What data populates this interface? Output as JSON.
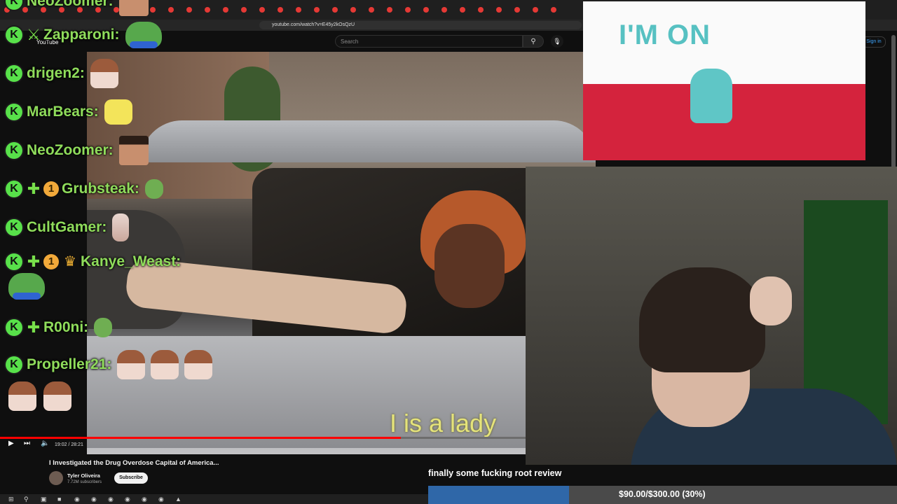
{
  "browser": {
    "url": "youtube.com/watch?v=E45y2kOsQzU",
    "tab_count": 31
  },
  "youtube": {
    "logo": "YouTube",
    "search_placeholder": "Search",
    "sign_in": "Sign in"
  },
  "video": {
    "subtitle": "I is a lady",
    "timecode": "19:02 / 28:21",
    "progress_fraction": 0.673,
    "title": "I Investigated the Drug Overdose Capital of America...",
    "channel": "Tyler Oliveira",
    "subscribers": "7.72M subscribers",
    "subscribe_label": "Subscribe"
  },
  "chat": [
    {
      "user": "NeoZoomer:",
      "badges": [
        "k"
      ],
      "emotes": [
        "face"
      ]
    },
    {
      "user": "Zapparoni:",
      "badges": [
        "k",
        "sword"
      ],
      "emotes": [
        "frog"
      ]
    },
    {
      "user": "drigen2:",
      "badges": [
        "k"
      ],
      "emotes": [
        "anime"
      ]
    },
    {
      "user": "MarBears:",
      "badges": [
        "k"
      ],
      "emotes": [
        "cat"
      ]
    },
    {
      "user": "NeoZoomer:",
      "badges": [
        "k"
      ],
      "emotes": [
        "face"
      ]
    },
    {
      "user": "Grubsteak:",
      "badges": [
        "k",
        "cross",
        "one"
      ],
      "emotes": [
        "pepe-small"
      ]
    },
    {
      "user": "CultGamer:",
      "badges": [
        "k"
      ],
      "emotes": [
        "girl"
      ]
    },
    {
      "user": "Kanye_Weast:",
      "badges": [
        "k",
        "cross",
        "one",
        "crown"
      ],
      "emotes": []
    },
    {
      "user": "R00ni:",
      "badges": [
        "k",
        "cross"
      ],
      "emotes": [
        "pepe-small"
      ]
    },
    {
      "user": "Propeller21:",
      "badges": [
        "k"
      ],
      "emotes": [
        "anime",
        "anime",
        "anime"
      ]
    }
  ],
  "overlay": {
    "miku_text": "I'M ON",
    "donation_message": "finally some fucking root review",
    "goal_text": "$90.00/$300.00 (30%)",
    "goal_fraction": 0.3
  },
  "colors": {
    "chat_name": "#8fdc5b",
    "k_badge": "#58e14a",
    "progress": "#ff0000",
    "goal_fill": "#2f67a8",
    "miku_red": "#d4233d",
    "miku_teal": "#57c1c2"
  },
  "icons": {
    "search": "search-icon",
    "mic": "mic-icon",
    "play": "play-icon",
    "next": "next-icon",
    "volume": "volume-icon"
  }
}
